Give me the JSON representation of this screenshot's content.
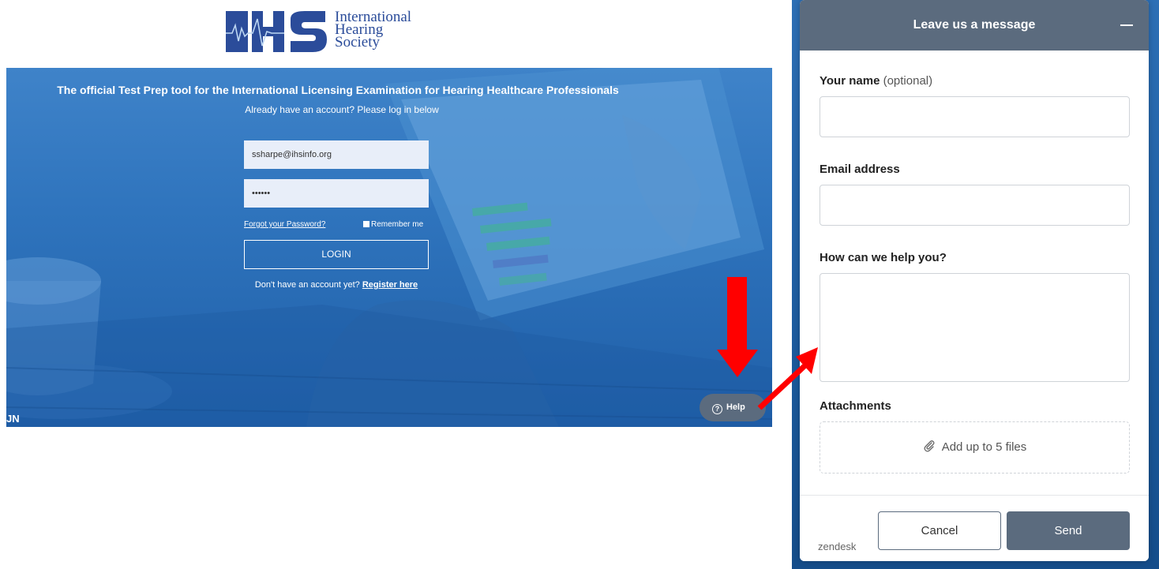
{
  "logo": {
    "mark": "IHS",
    "line1": "International",
    "line2": "Hearing",
    "line3": "Society"
  },
  "hero": {
    "title": "The official Test Prep tool for the International Licensing Examination for Hearing Healthcare Professionals",
    "subtitle": "Already have an account? Please log in below",
    "email_value": "ssharpe@ihsinfo.org",
    "password_value": "••••••",
    "forgot_label": "Forgot your Password?",
    "remember_label": "Remember me",
    "login_label": "LOGIN",
    "register_prompt": "Don't have an account yet?",
    "register_link": "Register here",
    "bottom_fragment": "JN",
    "help_label": "Help",
    "help_icon": "?"
  },
  "widget": {
    "title": "Leave us a message",
    "name_label": "Your name",
    "name_optional": "(optional)",
    "email_label": "Email address",
    "help_label": "How can we help you?",
    "attachments_label": "Attachments",
    "attach_text": "Add up to 5 files",
    "cancel_label": "Cancel",
    "send_label": "Send",
    "branding": "zendesk"
  },
  "colors": {
    "hero_blue": "#2f74bd",
    "widget_header": "#5b6b7e",
    "arrow_red": "#ff0000",
    "logo_blue": "#2b4c9a"
  },
  "icons": [
    "help-circle-icon",
    "paperclip-icon",
    "minimize-icon",
    "arrow-down-icon",
    "arrow-diagonal-icon"
  ]
}
